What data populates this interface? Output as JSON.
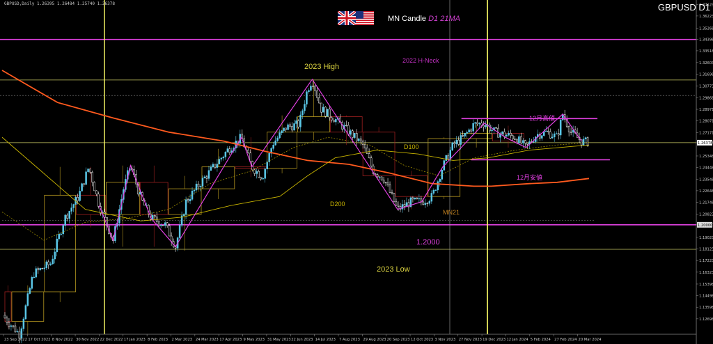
{
  "header": {
    "ohlc_line": "GBPUSD,Daily  1.26395 1.26484 1.25740 1.26378",
    "symbol_title": "GBPUSD D1",
    "mn_prefix": "MN Candle",
    "mn_suffix": "D1 21MA"
  },
  "annotations": {
    "high_2023": "2023 High",
    "neck_2022": "2022 H-Neck",
    "d100": "D100",
    "d200": "D200",
    "mn21": "MN21",
    "level_12000": "1.2000",
    "low_2023": "2023 Low",
    "dec_high": "12月高値",
    "dec_low": "12月安値"
  },
  "colors": {
    "background": "#000000",
    "candle_up": "#5bc8e8",
    "candle_down": "#ffffff",
    "ma200": "#ff5a1e",
    "ma100": "#c8b400",
    "ma21": "#b4a000",
    "vline": "#ffff66",
    "magenta": "#e040e0",
    "level": "#c8c864",
    "mn_box": "#b89a20",
    "mn_box_down": "#a02020",
    "flag_red": "#cc1122",
    "flag_blue": "#1a2f7a"
  },
  "chart_data": {
    "type": "candlestick",
    "symbol": "GBPUSD",
    "timeframe": "D1",
    "ylim": [
      1.115,
      1.373
    ],
    "y_ticks": [
      "1.37123",
      "1.36223",
      "1.35268",
      "1.34398",
      "1.33518",
      "1.32603",
      "1.31698",
      "1.30773",
      "1.29868",
      "1.28971",
      "1.28071",
      "1.27171",
      "1.26378",
      "1.25348",
      "1.24448",
      "1.23548",
      "1.22648",
      "1.21748",
      "1.20823",
      "1.20000",
      "1.19023",
      "1.18123",
      "1.17223",
      "1.16323",
      "1.15398",
      "1.14498",
      "1.13598",
      "1.12698"
    ],
    "x_ticks": [
      "23 Sep 2022",
      "17 Oct 2022",
      "8 Nov 2022",
      "30 Nov 2022",
      "22 Dec 2022",
      "17 Jan 2023",
      "8 Feb 2023",
      "2 Mar 2023",
      "24 Mar 2023",
      "17 Apr 2023",
      "9 May 2023",
      "31 May 2023",
      "22 Jun 2023",
      "14 Jul 2023",
      "7 Aug 2023",
      "29 Aug 2023",
      "20 Sep 2023",
      "12 Oct 2023",
      "3 Nov 2023",
      "27 Nov 2023",
      "19 Dec 2023",
      "12 Jan 2024",
      "5 Feb 2024",
      "27 Feb 2024",
      "20 Mar 2024"
    ],
    "price_path": [
      [
        0,
        1.13
      ],
      [
        25,
        1.115
      ],
      [
        45,
        1.162
      ],
      [
        70,
        1.17
      ],
      [
        90,
        1.205
      ],
      [
        110,
        1.222
      ],
      [
        125,
        1.245
      ],
      [
        140,
        1.215
      ],
      [
        160,
        1.188
      ],
      [
        175,
        1.228
      ],
      [
        185,
        1.246
      ],
      [
        200,
        1.22
      ],
      [
        215,
        1.205
      ],
      [
        235,
        1.2
      ],
      [
        250,
        1.183
      ],
      [
        265,
        1.218
      ],
      [
        285,
        1.232
      ],
      [
        305,
        1.245
      ],
      [
        325,
        1.258
      ],
      [
        345,
        1.268
      ],
      [
        360,
        1.245
      ],
      [
        375,
        1.237
      ],
      [
        390,
        1.263
      ],
      [
        410,
        1.276
      ],
      [
        428,
        1.278
      ],
      [
        440,
        1.305
      ],
      [
        447,
        1.313
      ],
      [
        460,
        1.29
      ],
      [
        480,
        1.282
      ],
      [
        500,
        1.272
      ],
      [
        520,
        1.262
      ],
      [
        535,
        1.242
      ],
      [
        550,
        1.236
      ],
      [
        570,
        1.212
      ],
      [
        590,
        1.218
      ],
      [
        605,
        1.218
      ],
      [
        620,
        1.222
      ],
      [
        635,
        1.245
      ],
      [
        650,
        1.262
      ],
      [
        665,
        1.268
      ],
      [
        680,
        1.278
      ],
      [
        695,
        1.279
      ],
      [
        710,
        1.272
      ],
      [
        725,
        1.27
      ],
      [
        740,
        1.268
      ],
      [
        755,
        1.26
      ],
      [
        770,
        1.27
      ],
      [
        785,
        1.272
      ],
      [
        800,
        1.268
      ],
      [
        808,
        1.286
      ],
      [
        820,
        1.272
      ],
      [
        835,
        1.265
      ],
      [
        846,
        1.264
      ]
    ],
    "ma200_path": [
      [
        0,
        1.32
      ],
      [
        80,
        1.295
      ],
      [
        160,
        1.283
      ],
      [
        240,
        1.272
      ],
      [
        320,
        1.265
      ],
      [
        380,
        1.257
      ],
      [
        440,
        1.25
      ],
      [
        500,
        1.247
      ],
      [
        560,
        1.24
      ],
      [
        620,
        1.232
      ],
      [
        680,
        1.23
      ],
      [
        705,
        1.23
      ],
      [
        760,
        1.232
      ],
      [
        800,
        1.233
      ],
      [
        846,
        1.236
      ]
    ],
    "ma100_path": [
      [
        0,
        1.268
      ],
      [
        60,
        1.24
      ],
      [
        120,
        1.212
      ],
      [
        200,
        1.203
      ],
      [
        260,
        1.206
      ],
      [
        330,
        1.215
      ],
      [
        400,
        1.222
      ],
      [
        440,
        1.238
      ],
      [
        480,
        1.252
      ],
      [
        540,
        1.258
      ],
      [
        600,
        1.255
      ],
      [
        650,
        1.25
      ],
      [
        700,
        1.252
      ],
      [
        760,
        1.258
      ],
      [
        846,
        1.262
      ]
    ],
    "ma21_path": [
      [
        0,
        1.21
      ],
      [
        60,
        1.188
      ],
      [
        120,
        1.202
      ],
      [
        180,
        1.205
      ],
      [
        240,
        1.212
      ],
      [
        300,
        1.232
      ],
      [
        360,
        1.242
      ],
      [
        420,
        1.26
      ],
      [
        470,
        1.268
      ],
      [
        530,
        1.262
      ],
      [
        580,
        1.246
      ],
      [
        630,
        1.238
      ],
      [
        680,
        1.252
      ],
      [
        740,
        1.258
      ],
      [
        800,
        1.262
      ],
      [
        846,
        1.264
      ]
    ],
    "mn_boxes": [
      {
        "x0": 4,
        "x1": 13,
        "open": 1.148,
        "close": 1.125,
        "high": 1.153,
        "low": 1.12
      },
      {
        "x0": 14,
        "x1": 60,
        "open": 1.125,
        "close": 1.148,
        "high": 1.153,
        "low": 1.115
      },
      {
        "x0": 61,
        "x1": 106,
        "open": 1.148,
        "close": 1.223,
        "high": 1.245,
        "low": 1.14
      },
      {
        "x0": 107,
        "x1": 149,
        "open": 1.223,
        "close": 1.208,
        "high": 1.245,
        "low": 1.198
      },
      {
        "x0": 150,
        "x1": 198,
        "open": 1.208,
        "close": 1.233,
        "high": 1.246,
        "low": 1.183
      },
      {
        "x0": 199,
        "x1": 239,
        "open": 1.233,
        "close": 1.208,
        "high": 1.246,
        "low": 1.183
      },
      {
        "x0": 240,
        "x1": 287,
        "open": 1.208,
        "close": 1.228,
        "high": 1.238,
        "low": 1.18
      },
      {
        "x0": 288,
        "x1": 335,
        "open": 1.228,
        "close": 1.245,
        "high": 1.259,
        "low": 1.22
      },
      {
        "x0": 336,
        "x1": 381,
        "open": 1.245,
        "close": 1.244,
        "high": 1.268,
        "low": 1.237
      },
      {
        "x0": 382,
        "x1": 425,
        "open": 1.244,
        "close": 1.272,
        "high": 1.285,
        "low": 1.24
      },
      {
        "x0": 426,
        "x1": 472,
        "open": 1.272,
        "close": 1.284,
        "high": 1.313,
        "low": 1.266
      },
      {
        "x0": 473,
        "x1": 519,
        "open": 1.284,
        "close": 1.272,
        "high": 1.285,
        "low": 1.262
      },
      {
        "x0": 520,
        "x1": 566,
        "open": 1.272,
        "close": 1.238,
        "high": 1.276,
        "low": 1.235
      },
      {
        "x0": 567,
        "x1": 613,
        "open": 1.238,
        "close": 1.222,
        "high": 1.242,
        "low": 1.212
      },
      {
        "x0": 614,
        "x1": 660,
        "open": 1.222,
        "close": 1.267,
        "high": 1.268,
        "low": 1.22
      },
      {
        "x0": 661,
        "x1": 706,
        "open": 1.267,
        "close": 1.271,
        "high": 1.278,
        "low": 1.26
      },
      {
        "x0": 707,
        "x1": 752,
        "open": 1.271,
        "close": 1.265,
        "high": 1.277,
        "low": 1.26
      }
    ],
    "levels": [
      {
        "name": "neck_2022",
        "price": 1.344,
        "color": "magenta"
      },
      {
        "name": "high_2023",
        "price": 1.3125,
        "color": "level"
      },
      {
        "name": "dotted_upper",
        "price": 1.3004,
        "color": "grey"
      },
      {
        "name": "current",
        "price": 1.2638,
        "color": "level"
      },
      {
        "name": "level_12000",
        "price": 1.2,
        "color": "magenta"
      },
      {
        "name": "low_2023",
        "price": 1.181,
        "color": "level"
      }
    ],
    "range_top": 1.2825,
    "range_bottom": 1.2505,
    "grid": false
  }
}
